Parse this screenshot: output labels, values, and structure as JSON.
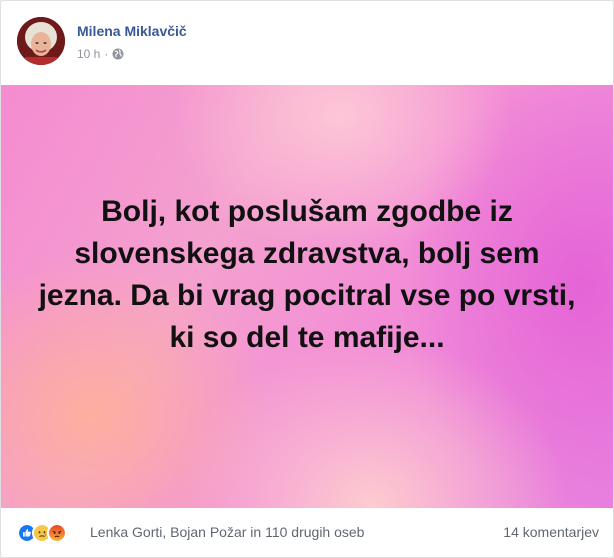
{
  "post": {
    "author": "Milena Miklavčič",
    "time": "10 h",
    "separator": "·",
    "privacy_icon": "globe-icon",
    "text": "Bolj, kot poslušam zgodbe iz slovenskega zdravstva, bolj sem jezna. Da bi vrag pocitral vse po vrsti, ki so del te mafije..."
  },
  "footer": {
    "reaction_icons": [
      "like-icon",
      "sad-icon",
      "angry-icon"
    ],
    "reactions_text": "Lenka Gorti, Bojan Požar in 110 drugih oseb",
    "comments_text": "14 komentarjev"
  },
  "colors": {
    "author_link": "#385898",
    "meta_text": "#90949c",
    "footer_text": "#606770",
    "like_blue": "#1877f2",
    "background_pink": "#f58bd0"
  }
}
